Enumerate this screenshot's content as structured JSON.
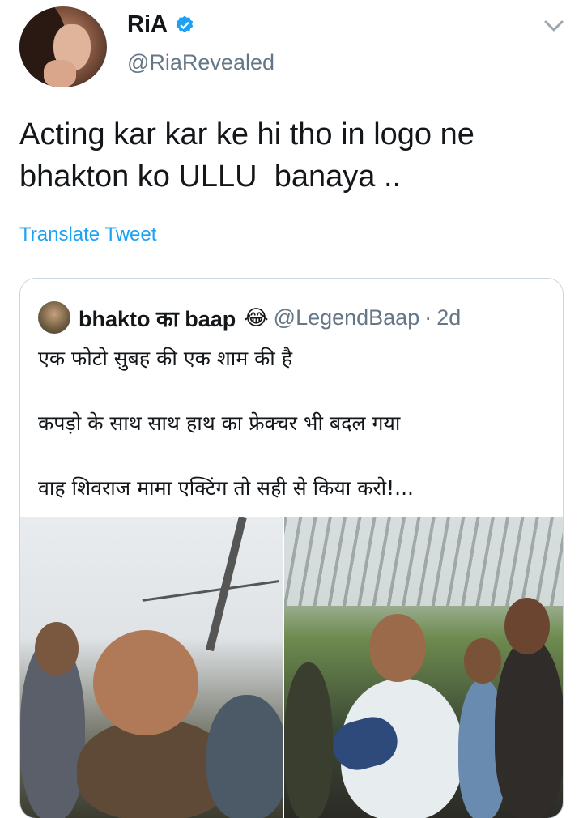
{
  "tweet": {
    "display_name": "RiA",
    "handle": "@RiaRevealed",
    "text_lines": [
      "Acting kar kar ke hi tho in logo ne",
      "bhakton ko ULLU  banaya .."
    ],
    "translate_label": "Translate Tweet"
  },
  "quoted": {
    "display_name": "bhakto का baap",
    "emoji": "😂",
    "handle": "@LegendBaap",
    "separator": "·",
    "time": "2d",
    "lines": [
      "एक फोटो सुबह की एक शाम की है",
      "कपड़ो के साथ साथ हाथ का फ्रेक्चर भी बदल गया",
      "वाह शिवराज मामा एक्टिंग तो सही से किया करो!..."
    ]
  },
  "colors": {
    "link": "#1da1f2",
    "muted": "#657786",
    "text": "#14171a",
    "verified": "#1da1f2",
    "border": "#ccd6dd"
  },
  "icons": {
    "verified": "verified-badge-icon",
    "menu": "chevron-down-icon"
  }
}
